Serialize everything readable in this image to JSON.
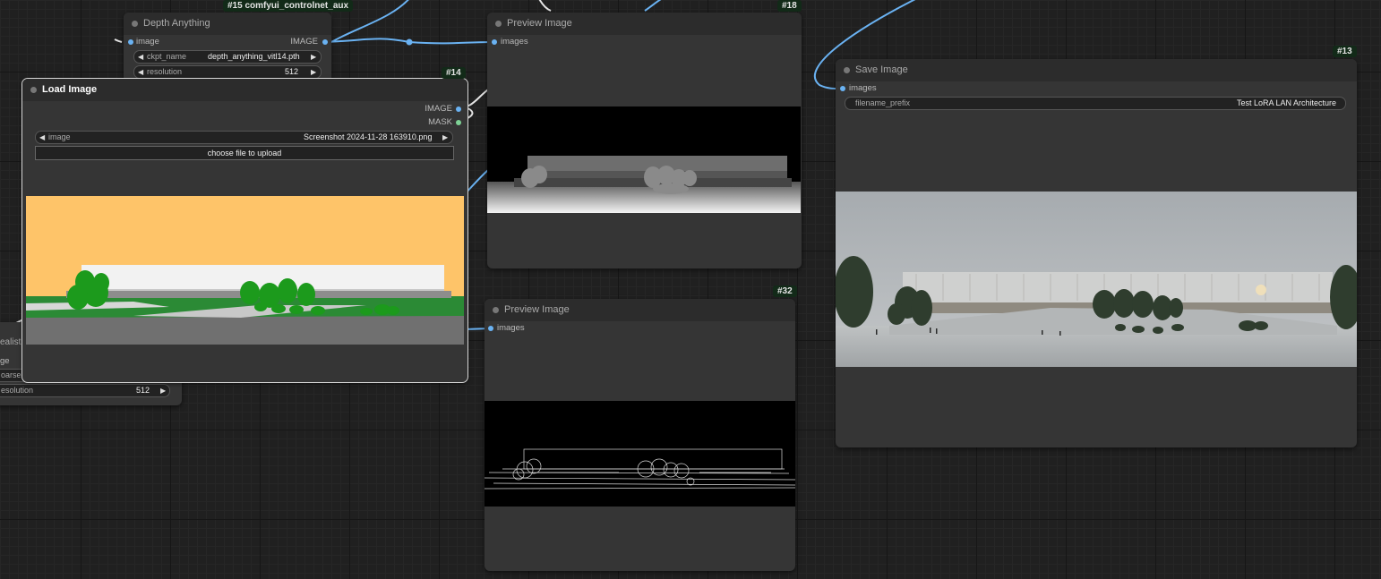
{
  "colors": {
    "link": "#6ab2f2",
    "mask_link": "#7ed296",
    "canvas": "#202020",
    "node": "#353535",
    "badge": "#122a18"
  },
  "nodes": {
    "depth_anything": {
      "badge": "#15 comfyui_controlnet_aux",
      "title": "Depth Anything",
      "input_image": "image",
      "output_image": "IMAGE",
      "ckpt_label": "ckpt_name",
      "ckpt_value": "depth_anything_vitl14.pth",
      "res_label": "resolution",
      "res_value": "512"
    },
    "load_image": {
      "badge": "#14",
      "title": "Load Image",
      "output_image": "IMAGE",
      "output_mask": "MASK",
      "image_label": "image",
      "image_value": "Screenshot 2024-11-28 163910.png",
      "upload_label": "choose file to upload"
    },
    "partial_node": {
      "title_fragment": "ealistic",
      "slot_fragment": "ge",
      "coarse_fragment": "oarse",
      "res_label": "esolution",
      "res_value": "512"
    },
    "preview_18": {
      "badge": "#18",
      "title": "Preview Image",
      "input_images": "images"
    },
    "preview_32": {
      "badge": "#32",
      "title": "Preview Image",
      "input_images": "images"
    },
    "save_image": {
      "badge": "#13",
      "title": "Save Image",
      "input_images": "images",
      "prefix_label": "filename_prefix",
      "prefix_value": "Test LoRA LAN Architecture"
    }
  },
  "icons": {
    "left": "◀",
    "right": "▶"
  }
}
